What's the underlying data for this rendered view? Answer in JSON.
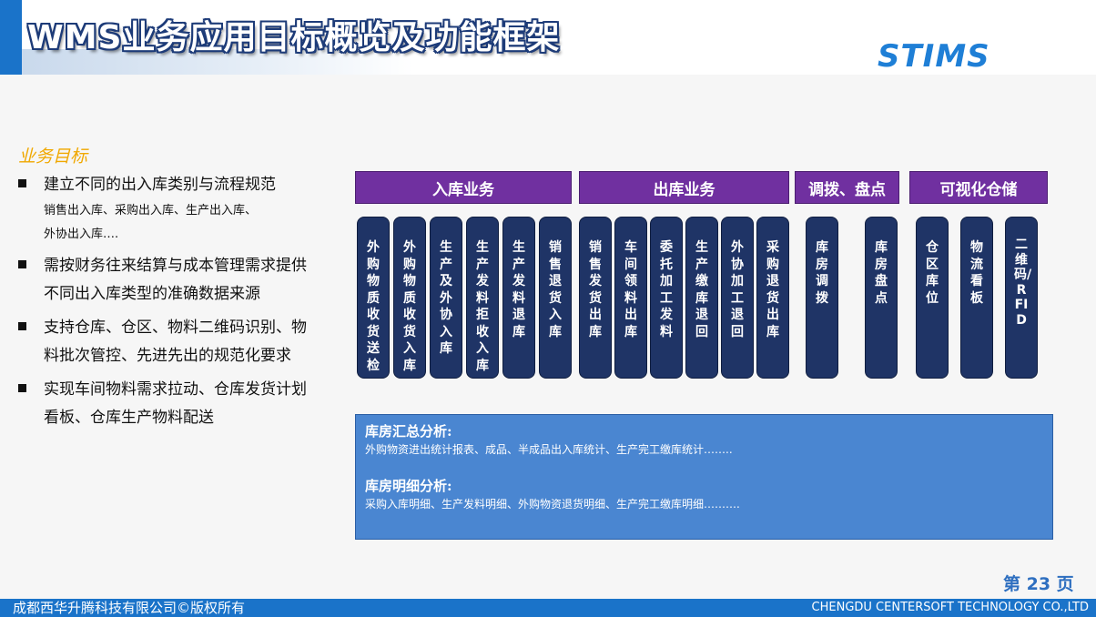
{
  "header": {
    "title": "WMS业务应用目标概览及功能框架",
    "logo_text": "STIMS"
  },
  "goals": {
    "title": "业务目标",
    "item1": "建立不同的出入库类别与流程规范",
    "item1_sub": "销售出入库、采购出入库、生产出入库、",
    "item1_sub2": "外协出入库….",
    "item2": "需按财务往来结算与成本管理需求提供不同出入库类型的准确数据来源",
    "item3": "支持仓库、仓区、物料二维码识别、物料批次管控、先进先出的规范化要求",
    "item4": "实现车间物料需求拉动、仓库发货计划看板、仓库生产物料配送"
  },
  "categories": {
    "inbound": "入库业务",
    "outbound": "出库业务",
    "transfer": "调拨、盘点",
    "visual": "可视化仓储"
  },
  "modules": [
    "外购物质收货送检",
    "外购物质收货入库",
    "生产及外协入库",
    "生产发料拒收入库",
    "生产发料退库",
    "销售退货入库",
    "销售发货出库",
    "车间领料出库",
    "委托加工发料",
    "生产缴库退回",
    "外协加工退回",
    "采购退货出库",
    "库房调拨",
    "库房盘点",
    "仓区库位",
    "物流看板",
    "二维码/RFID"
  ],
  "analysis": {
    "summary_title": "库房汇总分析:",
    "summary_text": "外购物资进出统计报表、成品、半成品出入库统计、生产完工缴库统计……..",
    "detail_title": "库房明细分析:",
    "detail_text": "采购入库明细、生产发料明细、外购物资退货明细、生产完工缴库明细………."
  },
  "page_label": "第 23 页",
  "footer": {
    "left": "成都西华升腾科技有限公司©版权所有",
    "right": "CHENGDU CENTERSOFT TECHNOLOGY CO.,LTD"
  },
  "colors": {
    "brand_blue": "#1a73c9",
    "category_purple": "#7030a0",
    "module_navy": "#1f3466",
    "analysis_blue": "#4a86d1",
    "goal_title_gold": "#f0a800"
  }
}
